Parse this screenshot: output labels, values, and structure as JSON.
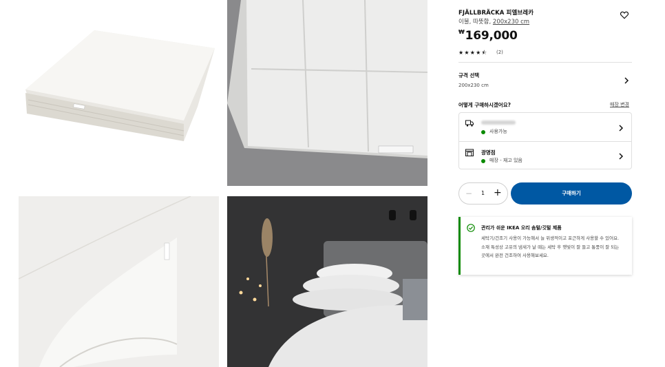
{
  "product": {
    "name": "FJÄLLBRÄCKA 피엘브레카",
    "description": "이불, 따뜻함,",
    "size_link": "200x230 cm",
    "currency": "₩",
    "price": "169,000",
    "rating": 4.5,
    "rating_stars": "★★★★⯪",
    "review_count": "(2)"
  },
  "size_selector": {
    "label": "규격 선택",
    "value": "200x230 cm"
  },
  "purchase": {
    "heading": "어떻게 구매하시겠어요?",
    "change_store": "매장 변경",
    "options": [
      {
        "icon": "delivery-truck-icon",
        "title": "",
        "status": "사용가능"
      },
      {
        "icon": "store-icon",
        "title": "광명점",
        "status": "매장 - 재고 있음"
      }
    ],
    "status_color": "#0a8a00"
  },
  "cart": {
    "quantity": "1",
    "minus": "−",
    "plus": "+",
    "buy_label": "구매하기",
    "accent": "#0058a3"
  },
  "info_card": {
    "icon": "check-circle-icon",
    "title": "관리가 쉬운 IKEA 오리 솜털/깃털 제품",
    "body": "세탁기/건조기 사용이 가능해서 늘 위생적이고 포근하게 사용할 수 있어요. 소재 특성상 고유의 냄새가 날 때는 세탁 후 햇빛이 잘 들고 통풍이 잘 되는 곳에서 완전 건조하여 사용해보세요."
  },
  "gallery": [
    {
      "icon": "folded-duvet-image"
    },
    {
      "icon": "duvet-closeup-image"
    },
    {
      "icon": "duvet-corner-image"
    },
    {
      "icon": "bedroom-image"
    }
  ]
}
